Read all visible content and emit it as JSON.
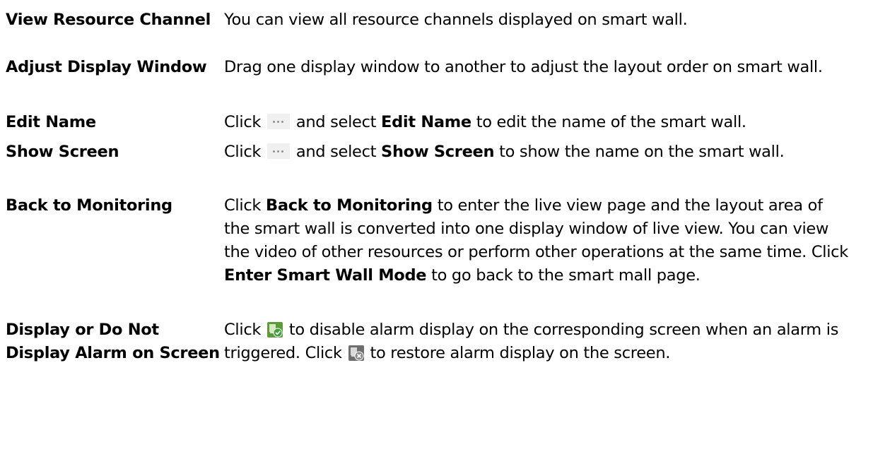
{
  "rows": [
    {
      "term": "View Resource Channel",
      "desc": "You can view all resource channels displayed on smart wall."
    },
    {
      "term": "Adjust Display Window",
      "desc": "Drag one display window to another to adjust the layout order on smart wall."
    },
    {
      "term": "Edit Name",
      "desc_pre": "Click",
      "desc_mid": "and select",
      "desc_bold": "Edit Name",
      "desc_post": "to edit the name of the smart wall."
    },
    {
      "term": "Show Screen",
      "desc_pre": "Click",
      "desc_mid": "and select",
      "desc_bold": "Show Screen",
      "desc_post": "to show the name on the smart wall."
    },
    {
      "term": "Back to Monitoring",
      "desc_pre": "Click",
      "desc_bold1": "Back to Monitoring",
      "desc_mid": "to enter the live view page and the layout area of the smart wall is converted into one display window of live view. You can view the video of other resources or perform other operations at the same time. Click",
      "desc_bold2": "Enter Smart Wall Mode",
      "desc_post": "to go back to the smart mall page."
    },
    {
      "term": "Display or Do Not Display Alarm on Screen",
      "desc_pre": "Click",
      "desc_mid": "to disable alarm display on the corresponding screen when an alarm is triggered. Click",
      "desc_post": "to restore alarm display on the screen."
    }
  ],
  "icons": {
    "more": "more-options-icon",
    "alarm_on": "alarm-display-enabled-icon",
    "alarm_off": "alarm-display-disabled-icon"
  }
}
